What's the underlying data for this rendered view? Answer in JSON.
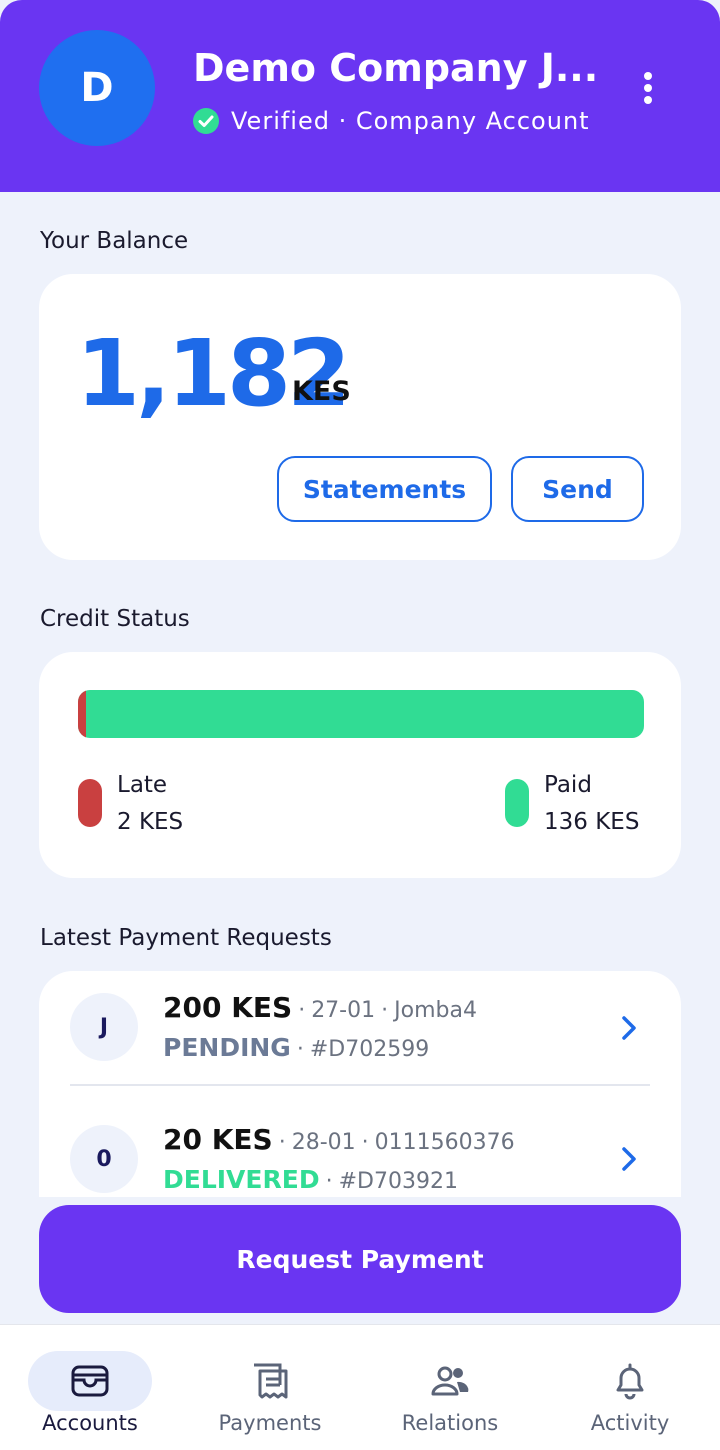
{
  "header": {
    "avatar_initial": "D",
    "company_name": "Demo Company J...",
    "verified_text": "Verified · Company Account",
    "background_color": "#6a35f2",
    "verified_icon": "check-circle-icon",
    "menu_icon": "kebab-menu-icon"
  },
  "balance": {
    "section_label": "Your Balance",
    "amount": "1,182",
    "currency": "KES",
    "statements_label": "Statements",
    "send_label": "Send",
    "accent_color": "#1e6ae8"
  },
  "credit": {
    "section_label": "Credit Status",
    "late_label": "Late",
    "late_value": "2 KES",
    "late_amount": 2,
    "paid_label": "Paid",
    "paid_value": "136 KES",
    "paid_amount": 136,
    "late_color": "#c94040",
    "paid_color": "#31dc94"
  },
  "requests": {
    "section_label": "Latest Payment Requests",
    "items": [
      {
        "initial": "J",
        "amount": "200 KES",
        "date": "27-01",
        "counterparty": "Jomba4",
        "status": "PENDING",
        "status_color": "#6b7a96",
        "ref": "#D702599"
      },
      {
        "initial": "0",
        "amount": "20 KES",
        "date": "28-01",
        "counterparty": "0111560376",
        "status": "DELIVERED",
        "status_color": "#31dc94",
        "ref": "#D703921"
      }
    ]
  },
  "primary_action": {
    "label": "Request Payment"
  },
  "nav": {
    "items": [
      {
        "label": "Accounts",
        "icon": "wallet-icon",
        "active": true
      },
      {
        "label": "Payments",
        "icon": "receipt-icon",
        "active": false
      },
      {
        "label": "Relations",
        "icon": "people-icon",
        "active": false
      },
      {
        "label": "Activity",
        "icon": "bell-icon",
        "active": false
      }
    ]
  }
}
